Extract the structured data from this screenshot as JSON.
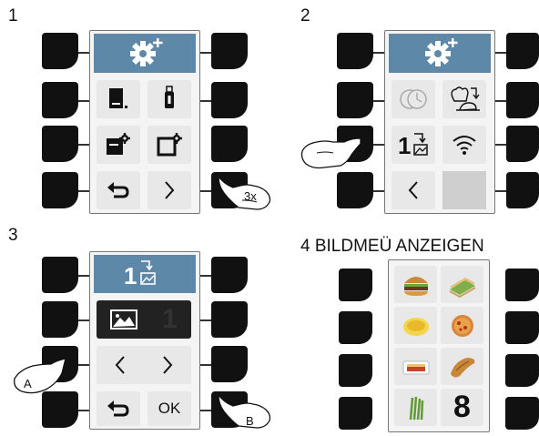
{
  "steps": {
    "s1": "1",
    "s2": "2",
    "s3": "3",
    "s4": "4 BILDMEÜ ANZEIGEN"
  },
  "panel1": {
    "press_label": "3x"
  },
  "panel3": {
    "value": "1",
    "ok_label": "OK",
    "callout_a": "A",
    "callout_b": "B"
  },
  "panel4": {
    "number": "8",
    "images": [
      "burger",
      "sandwich",
      "noodles",
      "pizza",
      "lasagna",
      "croissant",
      "asparagus"
    ]
  },
  "colors": {
    "header": "#5e88a8",
    "cell": "#e8e8e8",
    "key": "#111111"
  }
}
